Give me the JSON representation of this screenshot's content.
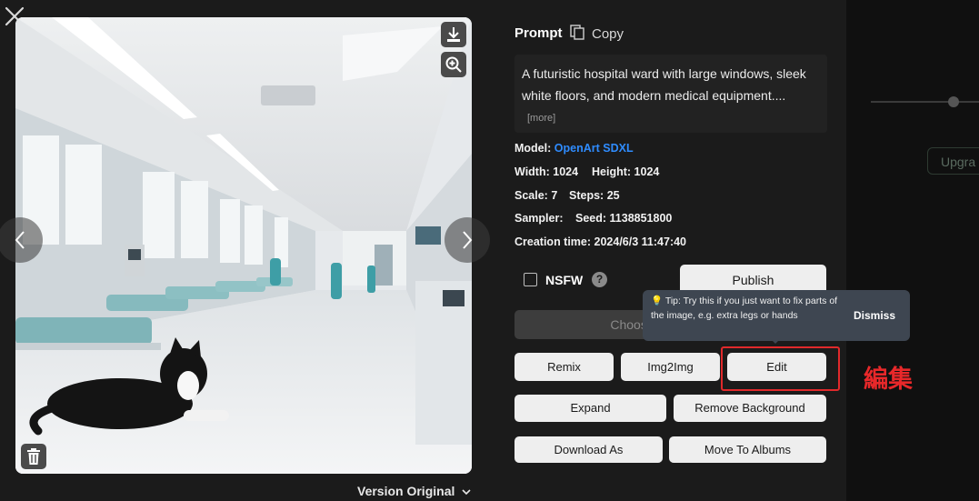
{
  "colors": {
    "accent_link": "#2f8cff",
    "annotation": "#e8282a",
    "tooltip_bg": "#3e4651"
  },
  "backdrop": {
    "upgrade_label": "Upgra"
  },
  "viewer": {
    "close_icon": "close-icon",
    "download_icon": "download-icon",
    "zoom_icon": "zoom-in-icon",
    "delete_icon": "trash-icon",
    "version_label": "Version Original"
  },
  "prompt": {
    "title": "Prompt",
    "copy_label": "Copy",
    "text": "A futuristic hospital ward with large windows, sleek white floors, and modern medical equipment....",
    "more_label": "[more]"
  },
  "meta": {
    "model_label": "Model:",
    "model_value": "OpenArt SDXL",
    "width_label": "Width:",
    "width_value": "1024",
    "height_label": "Height:",
    "height_value": "1024",
    "scale_label": "Scale:",
    "scale_value": "7",
    "steps_label": "Steps:",
    "steps_value": "25",
    "sampler_label": "Sampler:",
    "seed_label": "Seed:",
    "seed_value": "1138851800",
    "creation_label": "Creation time:",
    "creation_value": "2024/6/3 11:47:40"
  },
  "nsfw": {
    "label": "NSFW",
    "help": "?"
  },
  "buttons": {
    "publish": "Publish",
    "choose": "Choose U",
    "remix": "Remix",
    "img2img": "Img2Img",
    "edit": "Edit",
    "expand": "Expand",
    "remove_bg": "Remove Background",
    "download_as": "Download As",
    "move_to_albums": "Move To Albums"
  },
  "tooltip": {
    "icon": "💡",
    "text": "Tip: Try this if you just want to fix parts of the image, e.g. extra legs or hands",
    "dismiss": "Dismiss"
  },
  "annotation": {
    "text": "編集"
  }
}
